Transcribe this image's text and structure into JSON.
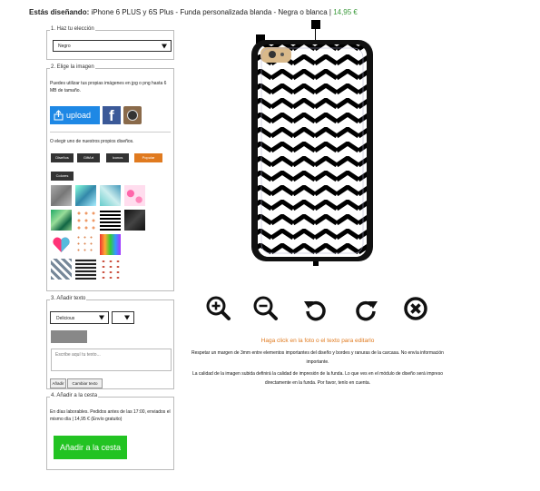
{
  "header": {
    "label": "Estás diseñando:",
    "product": "iPhone 6 PLUS y 6S Plus - Funda personalizada blanda - Negra o blanca",
    "separator": " | ",
    "price": "14,95 €"
  },
  "section1": {
    "legend": "1. Haz tu elección",
    "select_value": "Negro"
  },
  "section2": {
    "legend": "2. Elige la imagen",
    "intro": "Puedes utilizar tus propias imágenes en jpg o png hasta 6 MB de tamaño.",
    "upload_label": "upload",
    "or_text": "O elegir uno de nuestros propios diseños.",
    "tabs": [
      "Diseños",
      "GiftArt",
      "Iconos",
      "Popular",
      "Colores"
    ],
    "thumbnails": [
      "gray-marble",
      "blue-watercolor",
      "teal-marble",
      "pink-flamingos",
      "tropical-leaves",
      "donuts",
      "chevron",
      "black-marble",
      "pink-heart",
      "lollipops",
      "paint-drips",
      "triangles",
      "stripes",
      "lips"
    ]
  },
  "section3": {
    "legend": "3. Añadir texto",
    "font_value": "Delicious",
    "placeholder": "Escribe aquí tu texto...",
    "add_label": "Añadir",
    "change_label": "Cambiar texto"
  },
  "section4": {
    "legend": "4. Añadir a la cesta",
    "info": "En días laborables. Pedidos antes de las 17:00, enviados el mismo día | 14,95 € (Envío gratuito)",
    "cart_label": "Añadir a la cesta"
  },
  "editor": {
    "hint": "Haga click en la foto o el texto para editarlo",
    "note1": "Respetar un margen de 3mm entre elementos importantes del diseño y bordes y ranuras de la carcasa. No envía información importante.",
    "note2": "La calidad de la imagen subida definirá la calidad de impresión de la funda. Lo que ves en el módulo de diseño será impreso directamente en la funda. Por favor, tenlo en cuenta.",
    "tools": [
      "zoom-in-icon",
      "zoom-out-icon",
      "rotate-left-icon",
      "rotate-right-icon",
      "delete-icon"
    ]
  },
  "colors": {
    "upload": "#1e88e5",
    "popular_tab": "#e07a1f",
    "hint": "#e07a1f",
    "cart": "#22c322",
    "price": "#3c9a3c"
  }
}
